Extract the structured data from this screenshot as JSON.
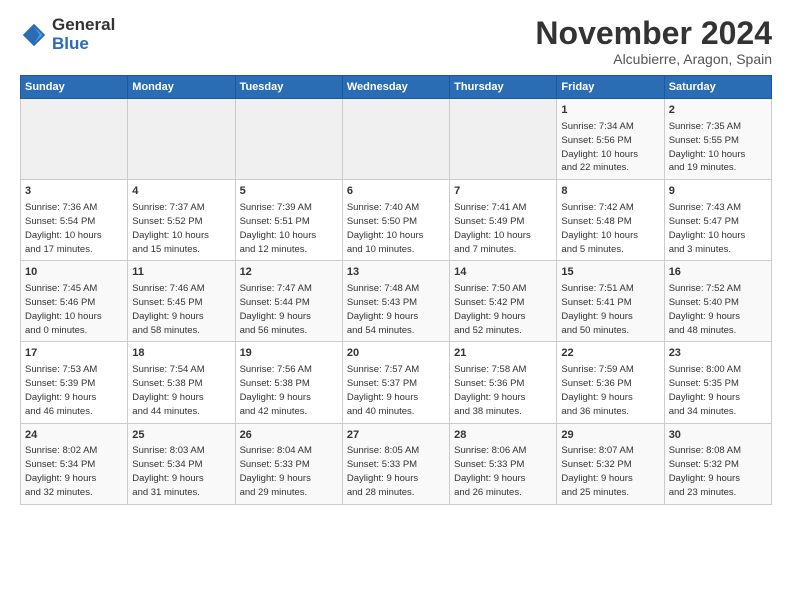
{
  "logo": {
    "line1": "General",
    "line2": "Blue"
  },
  "title": "November 2024",
  "location": "Alcubierre, Aragon, Spain",
  "days_of_week": [
    "Sunday",
    "Monday",
    "Tuesday",
    "Wednesday",
    "Thursday",
    "Friday",
    "Saturday"
  ],
  "weeks": [
    [
      {
        "day": "",
        "info": ""
      },
      {
        "day": "",
        "info": ""
      },
      {
        "day": "",
        "info": ""
      },
      {
        "day": "",
        "info": ""
      },
      {
        "day": "",
        "info": ""
      },
      {
        "day": "1",
        "info": "Sunrise: 7:34 AM\nSunset: 5:56 PM\nDaylight: 10 hours\nand 22 minutes."
      },
      {
        "day": "2",
        "info": "Sunrise: 7:35 AM\nSunset: 5:55 PM\nDaylight: 10 hours\nand 19 minutes."
      }
    ],
    [
      {
        "day": "3",
        "info": "Sunrise: 7:36 AM\nSunset: 5:54 PM\nDaylight: 10 hours\nand 17 minutes."
      },
      {
        "day": "4",
        "info": "Sunrise: 7:37 AM\nSunset: 5:52 PM\nDaylight: 10 hours\nand 15 minutes."
      },
      {
        "day": "5",
        "info": "Sunrise: 7:39 AM\nSunset: 5:51 PM\nDaylight: 10 hours\nand 12 minutes."
      },
      {
        "day": "6",
        "info": "Sunrise: 7:40 AM\nSunset: 5:50 PM\nDaylight: 10 hours\nand 10 minutes."
      },
      {
        "day": "7",
        "info": "Sunrise: 7:41 AM\nSunset: 5:49 PM\nDaylight: 10 hours\nand 7 minutes."
      },
      {
        "day": "8",
        "info": "Sunrise: 7:42 AM\nSunset: 5:48 PM\nDaylight: 10 hours\nand 5 minutes."
      },
      {
        "day": "9",
        "info": "Sunrise: 7:43 AM\nSunset: 5:47 PM\nDaylight: 10 hours\nand 3 minutes."
      }
    ],
    [
      {
        "day": "10",
        "info": "Sunrise: 7:45 AM\nSunset: 5:46 PM\nDaylight: 10 hours\nand 0 minutes."
      },
      {
        "day": "11",
        "info": "Sunrise: 7:46 AM\nSunset: 5:45 PM\nDaylight: 9 hours\nand 58 minutes."
      },
      {
        "day": "12",
        "info": "Sunrise: 7:47 AM\nSunset: 5:44 PM\nDaylight: 9 hours\nand 56 minutes."
      },
      {
        "day": "13",
        "info": "Sunrise: 7:48 AM\nSunset: 5:43 PM\nDaylight: 9 hours\nand 54 minutes."
      },
      {
        "day": "14",
        "info": "Sunrise: 7:50 AM\nSunset: 5:42 PM\nDaylight: 9 hours\nand 52 minutes."
      },
      {
        "day": "15",
        "info": "Sunrise: 7:51 AM\nSunset: 5:41 PM\nDaylight: 9 hours\nand 50 minutes."
      },
      {
        "day": "16",
        "info": "Sunrise: 7:52 AM\nSunset: 5:40 PM\nDaylight: 9 hours\nand 48 minutes."
      }
    ],
    [
      {
        "day": "17",
        "info": "Sunrise: 7:53 AM\nSunset: 5:39 PM\nDaylight: 9 hours\nand 46 minutes."
      },
      {
        "day": "18",
        "info": "Sunrise: 7:54 AM\nSunset: 5:38 PM\nDaylight: 9 hours\nand 44 minutes."
      },
      {
        "day": "19",
        "info": "Sunrise: 7:56 AM\nSunset: 5:38 PM\nDaylight: 9 hours\nand 42 minutes."
      },
      {
        "day": "20",
        "info": "Sunrise: 7:57 AM\nSunset: 5:37 PM\nDaylight: 9 hours\nand 40 minutes."
      },
      {
        "day": "21",
        "info": "Sunrise: 7:58 AM\nSunset: 5:36 PM\nDaylight: 9 hours\nand 38 minutes."
      },
      {
        "day": "22",
        "info": "Sunrise: 7:59 AM\nSunset: 5:36 PM\nDaylight: 9 hours\nand 36 minutes."
      },
      {
        "day": "23",
        "info": "Sunrise: 8:00 AM\nSunset: 5:35 PM\nDaylight: 9 hours\nand 34 minutes."
      }
    ],
    [
      {
        "day": "24",
        "info": "Sunrise: 8:02 AM\nSunset: 5:34 PM\nDaylight: 9 hours\nand 32 minutes."
      },
      {
        "day": "25",
        "info": "Sunrise: 8:03 AM\nSunset: 5:34 PM\nDaylight: 9 hours\nand 31 minutes."
      },
      {
        "day": "26",
        "info": "Sunrise: 8:04 AM\nSunset: 5:33 PM\nDaylight: 9 hours\nand 29 minutes."
      },
      {
        "day": "27",
        "info": "Sunrise: 8:05 AM\nSunset: 5:33 PM\nDaylight: 9 hours\nand 28 minutes."
      },
      {
        "day": "28",
        "info": "Sunrise: 8:06 AM\nSunset: 5:33 PM\nDaylight: 9 hours\nand 26 minutes."
      },
      {
        "day": "29",
        "info": "Sunrise: 8:07 AM\nSunset: 5:32 PM\nDaylight: 9 hours\nand 25 minutes."
      },
      {
        "day": "30",
        "info": "Sunrise: 8:08 AM\nSunset: 5:32 PM\nDaylight: 9 hours\nand 23 minutes."
      }
    ]
  ]
}
